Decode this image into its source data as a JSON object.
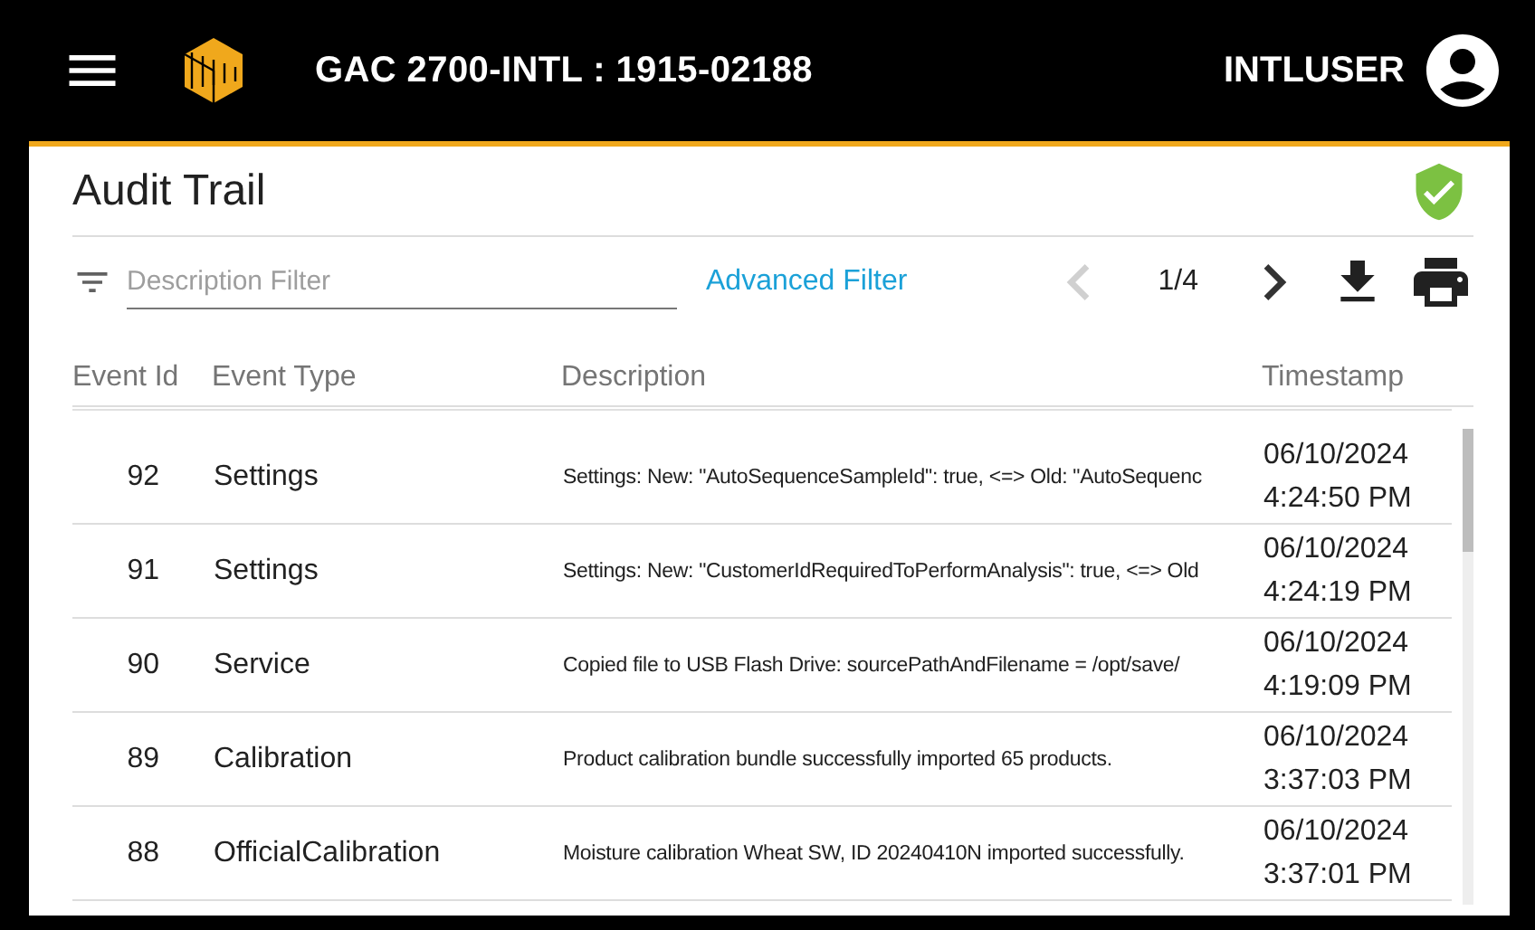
{
  "header": {
    "title": "GAC 2700-INTL : 1915-02188",
    "user": "INTLUSER"
  },
  "page": {
    "title": "Audit Trail",
    "verified": true
  },
  "toolbar": {
    "filter": {
      "placeholder": "Description Filter"
    },
    "advanced_filter": "Advanced Filter",
    "page": "1/4",
    "previous_disabled": true,
    "next_disabled": false
  },
  "table": {
    "columns": [
      "Event Id",
      "Event Type",
      "Description",
      "Timestamp"
    ],
    "rows": [
      {
        "kind": "full",
        "id": "92",
        "type": "Settings",
        "description": "Settings: New: \"AutoSequenceSampleId\": true, <=> Old: \"AutoSequenc",
        "date": "06/10/2024",
        "time": "4:24:50 PM"
      },
      {
        "kind": "full",
        "id": "91",
        "type": "Settings",
        "description": "Settings: New: \"CustomerIdRequiredToPerformAnalysis\": true, <=> Old",
        "date": "06/10/2024",
        "time": "4:24:19 PM"
      },
      {
        "kind": "full",
        "id": "90",
        "type": "Service",
        "description": "Copied file to USB Flash Drive: sourcePathAndFilename = /opt/save/",
        "date": "06/10/2024",
        "time": "4:19:09 PM"
      },
      {
        "kind": "full",
        "id": "89",
        "type": "Calibration",
        "description": "Product calibration bundle successfully imported 65 products.",
        "date": "06/10/2024",
        "time": "3:37:03 PM"
      },
      {
        "kind": "full",
        "id": "88",
        "type": "OfficialCalibration",
        "description": "Moisture calibration Wheat SW, ID 20240410N imported successfully.",
        "date": "06/10/2024",
        "time": "3:37:01 PM"
      }
    ]
  }
}
